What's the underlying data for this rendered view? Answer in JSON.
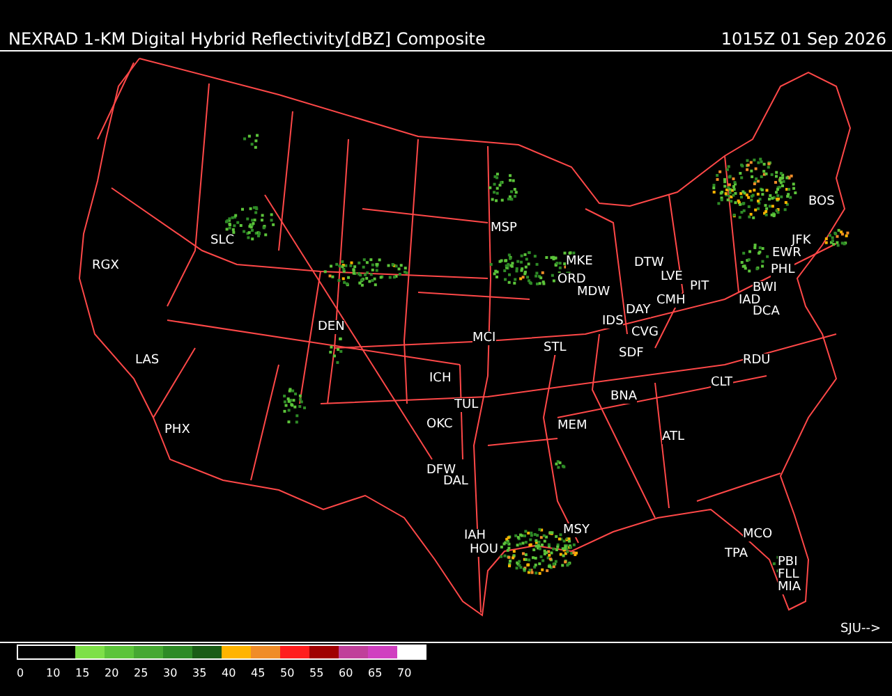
{
  "header": {
    "title": "NEXRAD 1-KM Digital Hybrid Reflectivity[dBZ] Composite",
    "timestamp": "1015Z 01 Sep 2026"
  },
  "map": {
    "stations": [
      "RGX",
      "SLC",
      "DEN",
      "LAS",
      "PHX",
      "ICH",
      "MCI",
      "MSP",
      "MKE",
      "ORD",
      "MDW",
      "DTW",
      "LVE",
      "PIT",
      "DAY",
      "CMH",
      "IDS",
      "CVG",
      "SDF",
      "STL",
      "BOS",
      "JFK",
      "EWR",
      "PHL",
      "BWI",
      "IAD",
      "DCA",
      "RDU",
      "CLT",
      "BNA",
      "ATL",
      "MEM",
      "TUL",
      "OKC",
      "DFW",
      "DAL",
      "IAH",
      "HOU",
      "MSY",
      "MCO",
      "TPA",
      "PBI",
      "FLL",
      "MIA"
    ],
    "offmap_link": "SJU-->"
  },
  "legend": {
    "bins": [
      {
        "label": "0",
        "color": "#000000"
      },
      {
        "label": "10",
        "color": "#000000"
      },
      {
        "label": "15",
        "color": "#7ee048"
      },
      {
        "label": "20",
        "color": "#5cc43a"
      },
      {
        "label": "25",
        "color": "#46a832"
      },
      {
        "label": "30",
        "color": "#2e8a26"
      },
      {
        "label": "35",
        "color": "#1a5c16"
      },
      {
        "label": "40",
        "color": "#ffb400"
      },
      {
        "label": "45",
        "color": "#f08c28"
      },
      {
        "label": "50",
        "color": "#ff1e1e"
      },
      {
        "label": "55",
        "color": "#a00000"
      },
      {
        "label": "60",
        "color": "#c0409a"
      },
      {
        "label": "65",
        "color": "#d040c0"
      },
      {
        "label": "70",
        "color": "#ffffff"
      }
    ]
  }
}
